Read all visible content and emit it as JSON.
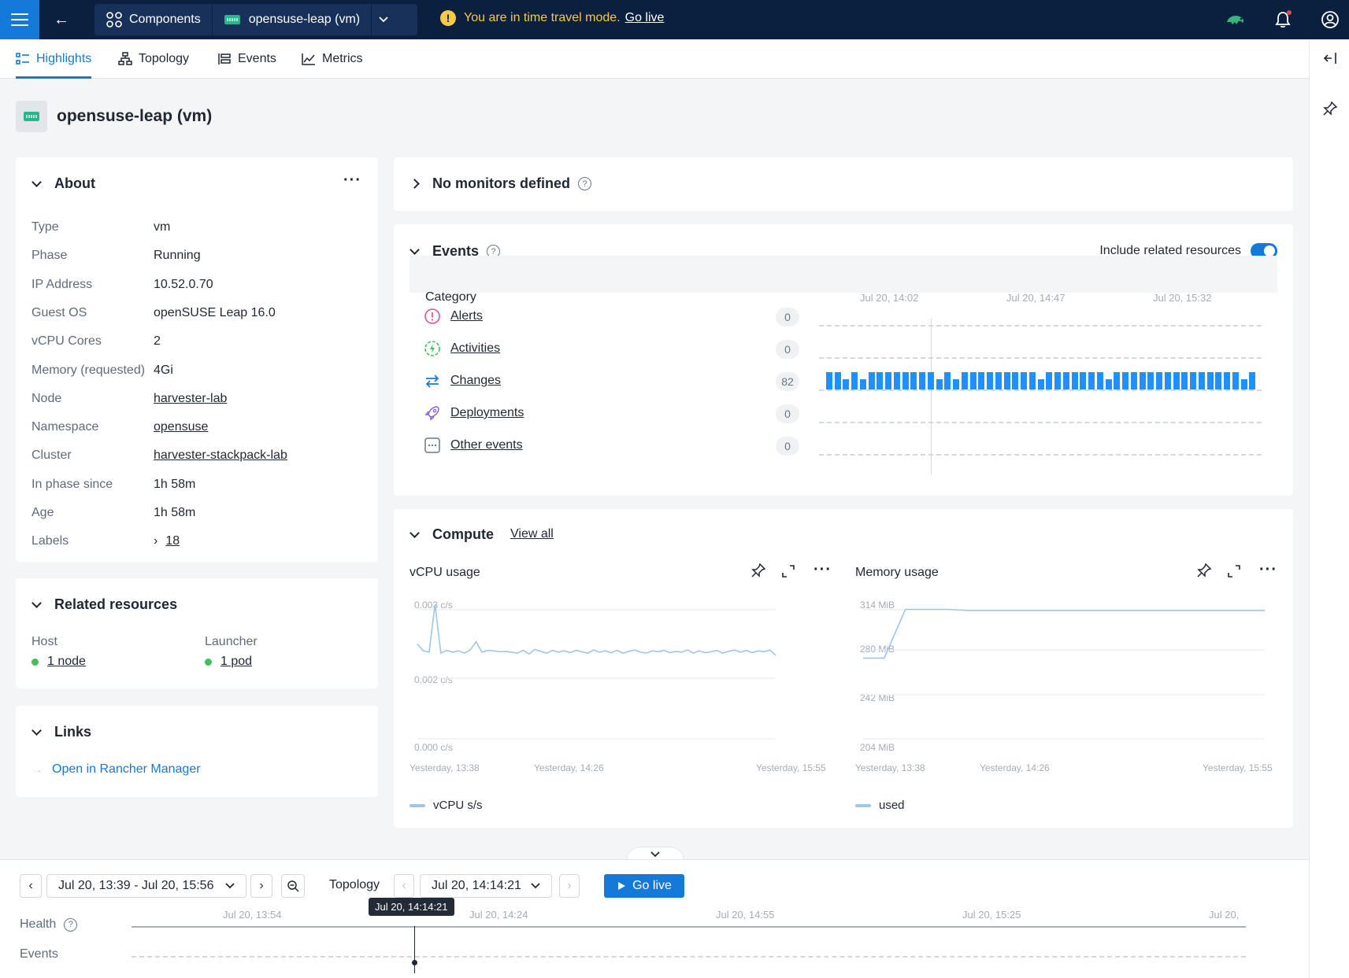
{
  "topbar": {
    "breadcrumbs": [
      {
        "label": "Components",
        "icon": "grid-icon"
      },
      {
        "label": "opensuse-leap (vm)",
        "icon": "vm-icon"
      }
    ],
    "banner_text": "You are in time travel mode.",
    "banner_link": "Go live"
  },
  "tabs": [
    {
      "label": "Highlights",
      "active": true
    },
    {
      "label": "Topology",
      "active": false
    },
    {
      "label": "Events",
      "active": false
    },
    {
      "label": "Metrics",
      "active": false
    }
  ],
  "page": {
    "title": "opensuse-leap (vm)"
  },
  "about": {
    "title": "About",
    "rows": [
      {
        "key": "Type",
        "value": "vm"
      },
      {
        "key": "Phase",
        "value": "Running"
      },
      {
        "key": "IP Address",
        "value": "10.52.0.70"
      },
      {
        "key": "Guest OS",
        "value": "openSUSE Leap 16.0"
      },
      {
        "key": "vCPU Cores",
        "value": "2"
      },
      {
        "key": "Memory (requested)",
        "value": "4Gi"
      },
      {
        "key": "Node",
        "value": "harvester-lab",
        "link": true
      },
      {
        "key": "Namespace",
        "value": "opensuse",
        "link": true
      },
      {
        "key": "Cluster",
        "value": "harvester-stackpack-lab",
        "link": true
      },
      {
        "key": "In phase since",
        "value": "1h 58m"
      },
      {
        "key": "Age",
        "value": "1h 58m"
      },
      {
        "key": "Labels",
        "value": "18",
        "link": true
      }
    ]
  },
  "related": {
    "title": "Related resources",
    "host_label": "Host",
    "host_value": "1 node",
    "launcher_label": "Launcher",
    "launcher_value": "1 pod"
  },
  "links": {
    "title": "Links",
    "item": "Open in Rancher Manager"
  },
  "monitors": {
    "title": "No monitors defined"
  },
  "events": {
    "title": "Events",
    "include_label": "Include related resources",
    "include_on": true,
    "category_header": "Category",
    "ticks": [
      "Jul 20, 14:02",
      "Jul 20, 14:47",
      "Jul 20, 15:32"
    ],
    "rows": [
      {
        "label": "Alerts",
        "count": "0",
        "icon": "alert-icon",
        "color": "#e0509b"
      },
      {
        "label": "Activities",
        "count": "0",
        "icon": "activity-icon",
        "color": "#3fbf5e"
      },
      {
        "label": "Changes",
        "count": "82",
        "icon": "changes-icon",
        "color": "#1479d9"
      },
      {
        "label": "Deployments",
        "count": "0",
        "icon": "rocket-icon",
        "color": "#8a63d2"
      },
      {
        "label": "Other events",
        "count": "0",
        "icon": "other-icon",
        "color": "#6b7685"
      }
    ],
    "changes_bars": [
      1,
      1,
      0.6,
      1,
      0.6,
      1,
      1,
      1,
      1,
      1,
      1,
      1,
      1,
      0.6,
      1,
      0.6,
      1,
      1,
      1,
      1,
      1,
      1,
      1,
      1,
      1,
      0.6,
      1,
      1,
      1,
      1,
      1,
      1,
      1,
      0.6,
      1,
      1,
      1,
      1,
      1,
      1,
      1,
      1,
      1,
      1,
      1,
      1,
      1,
      1,
      1,
      0.6,
      1
    ]
  },
  "compute": {
    "title": "Compute",
    "view_all": "View all",
    "cpu": {
      "title": "vCPU usage",
      "yticks": [
        "0.003 c/s",
        "0.002 c/s",
        "0.000 c/s"
      ],
      "xticks": [
        "Yesterday, 13:38",
        "Yesterday, 14:26",
        "Yesterday, 15:55"
      ],
      "legend": "vCPU s/s"
    },
    "memory": {
      "title": "Memory usage",
      "yticks": [
        "314 MiB",
        "280 MiB",
        "242 MiB",
        "204 MiB"
      ],
      "xticks": [
        "Yesterday, 13:38",
        "Yesterday, 14:26",
        "Yesterday, 15:55"
      ],
      "legend": "used"
    }
  },
  "chart_data": [
    {
      "type": "line",
      "title": "vCPU usage",
      "ylim": [
        0,
        0.003
      ],
      "series": [
        {
          "name": "vCPU s/s",
          "values": [
            0.0021,
            0.00195,
            0.00192,
            0.00298,
            0.0019,
            0.00196,
            0.00192,
            0.00195,
            0.0019,
            0.00197,
            0.00215,
            0.00192,
            0.00196,
            0.00195,
            0.00193,
            0.00194,
            0.00192,
            0.0019,
            0.00196,
            0.00188,
            0.00198,
            0.00194,
            0.0019,
            0.00196,
            0.00192,
            0.00195,
            0.00191,
            0.00196,
            0.00193,
            0.0019,
            0.00197,
            0.00192,
            0.00195,
            0.00191,
            0.00196,
            0.0019,
            0.00194,
            0.00197,
            0.00192,
            0.0019,
            0.00195,
            0.00193,
            0.00196,
            0.00191,
            0.00194,
            0.00192,
            0.00197,
            0.0019,
            0.00195,
            0.00191,
            0.00193,
            0.00196,
            0.0019,
            0.00194,
            0.00197,
            0.00192,
            0.00196,
            0.00191,
            0.00195,
            0.00193,
            0.00197,
            0.00185
          ]
        }
      ]
    },
    {
      "type": "line",
      "title": "Memory usage",
      "ylim": [
        204,
        314
      ],
      "series": [
        {
          "name": "used",
          "values": [
            272,
            272,
            313,
            313,
            313,
            312,
            312,
            312,
            312,
            312,
            312,
            312,
            312,
            312,
            312,
            312,
            312,
            312,
            312,
            312
          ]
        }
      ]
    }
  ],
  "timeline": {
    "range": "Jul 20, 13:39 - Jul 20, 15:56",
    "topology_label": "Topology",
    "timestamp": "Jul 20, 14:14:21",
    "go_live": "Go live",
    "tooltip": "Jul 20, 14:14:21",
    "health_label": "Health",
    "events_label": "Events",
    "ticks": [
      "Jul 20, 13:54",
      "Jul 20, 14:24",
      "Jul 20, 14:55",
      "Jul 20, 15:25",
      "Jul 20,"
    ]
  }
}
